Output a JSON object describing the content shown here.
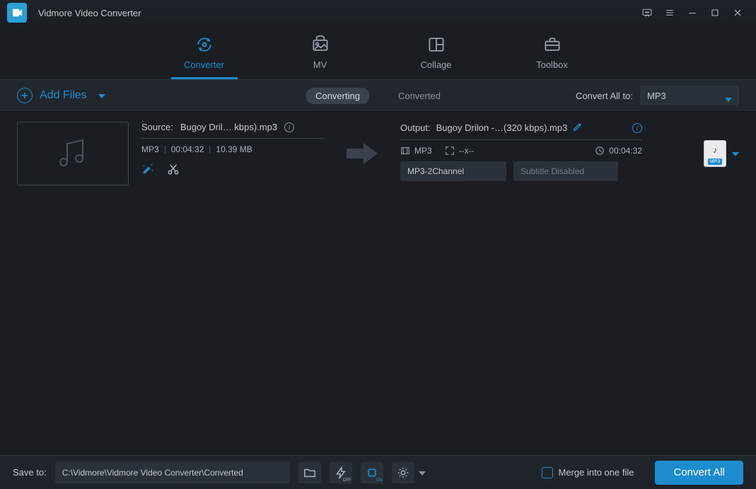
{
  "app": {
    "title": "Vidmore Video Converter"
  },
  "nav": {
    "items": [
      {
        "label": "Converter"
      },
      {
        "label": "MV"
      },
      {
        "label": "Collage"
      },
      {
        "label": "Toolbox"
      }
    ]
  },
  "subbar": {
    "add_files_label": "Add Files",
    "tabs": {
      "converting": "Converting",
      "converted": "Converted"
    },
    "convert_all_to_label": "Convert All to:",
    "convert_all_to_value": "MP3"
  },
  "item": {
    "source_label": "Source:",
    "source_name": "Bugoy Dril… kbps).mp3",
    "format": "MP3",
    "duration": "00:04:32",
    "size": "10.39 MB",
    "output_label": "Output:",
    "output_name": "Bugoy Drilon -…(320 kbps).mp3",
    "out_format": "MP3",
    "resolution": "--x--",
    "out_duration": "00:04:32",
    "audio_dd": "MP3-2Channel",
    "subtitle_dd": "Subtitle Disabled",
    "fmt_tile_tag": "MP3"
  },
  "bottom": {
    "save_to_label": "Save to:",
    "save_path": "C:\\Vidmore\\Vidmore Video Converter\\Converted",
    "hw_off": "OFF",
    "hw_on": "ON",
    "merge_label": "Merge into one file",
    "convert_btn": "Convert All"
  }
}
